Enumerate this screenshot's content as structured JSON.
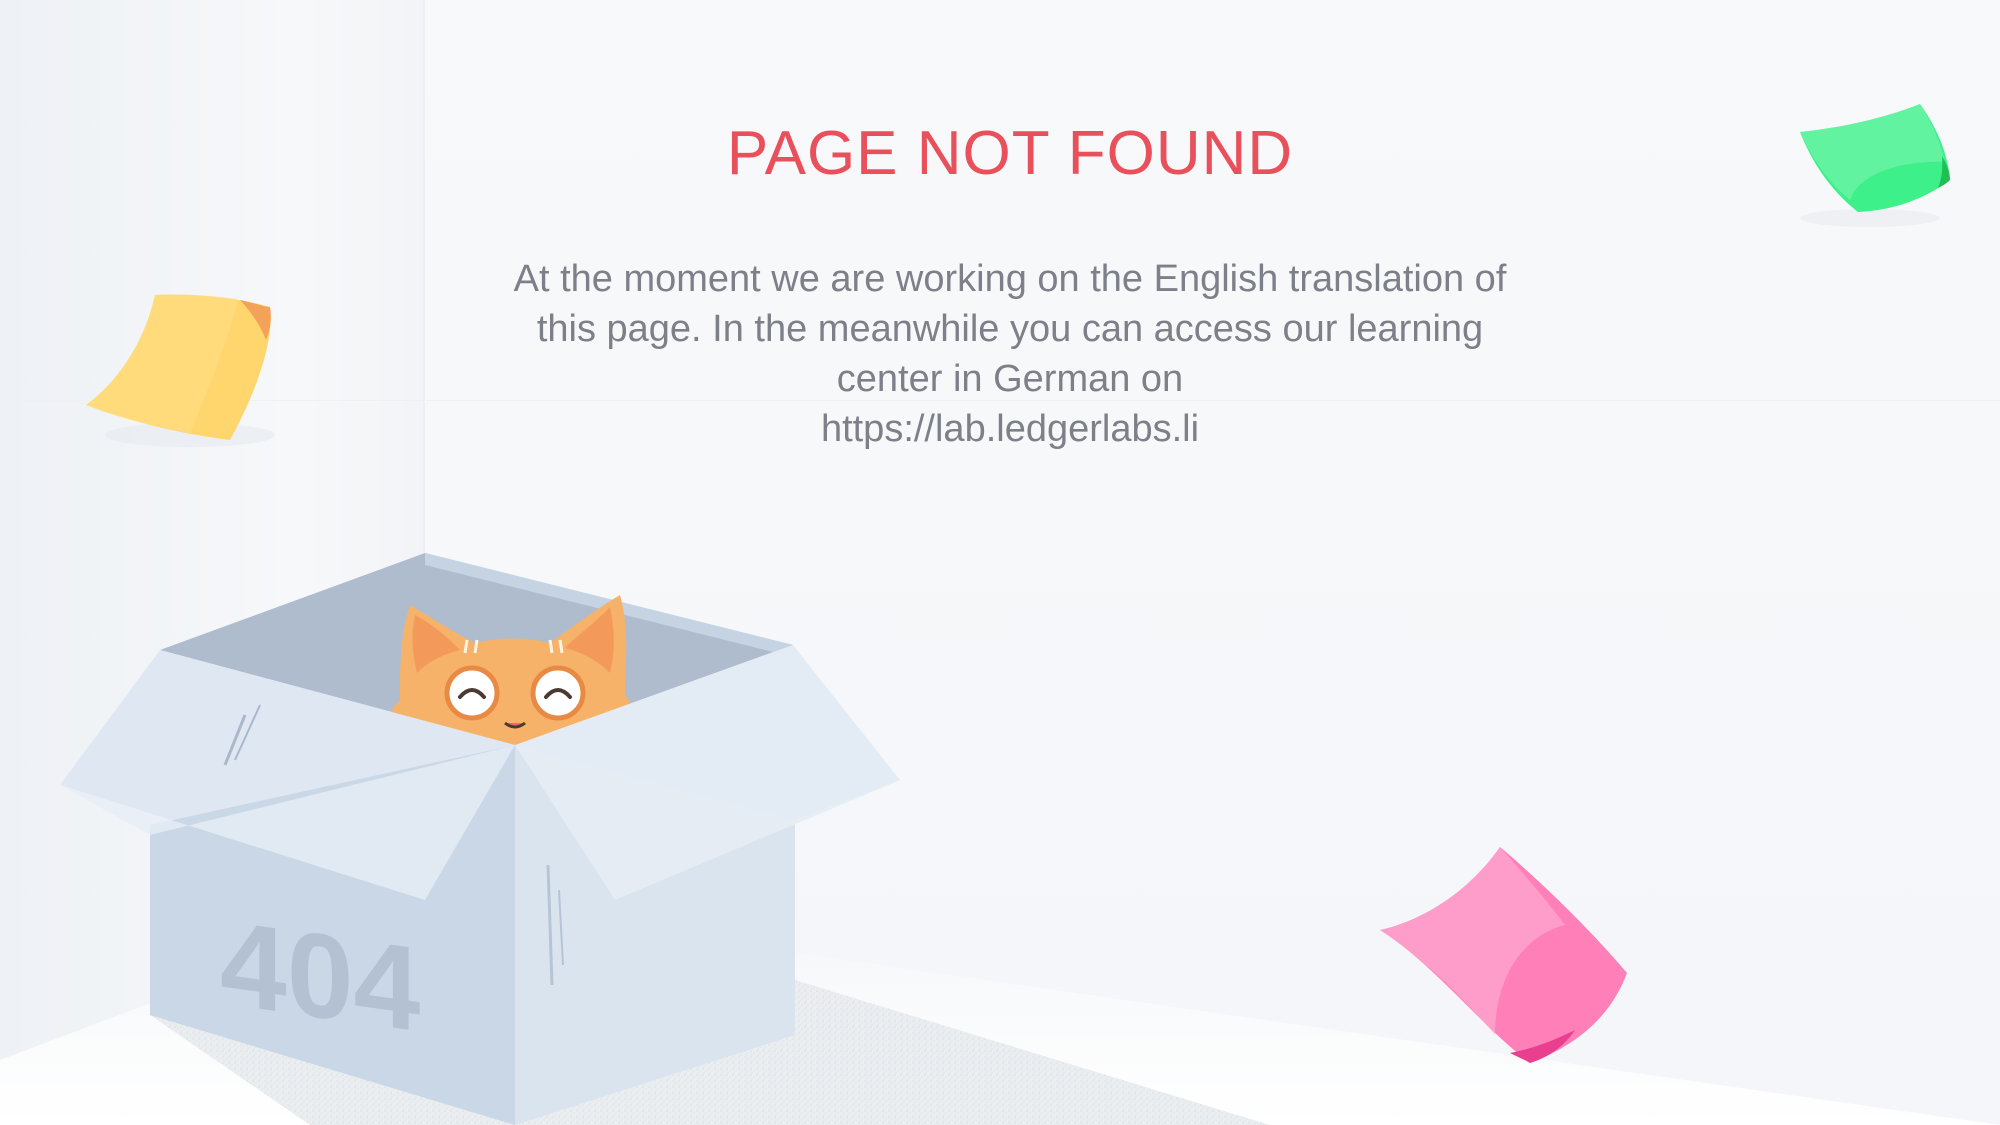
{
  "page": {
    "title": "PAGE NOT FOUND",
    "message_lines": [
      "At the moment we are working on the English translation of",
      "this page. In the meanwhile you can access our learning",
      "center in German on"
    ],
    "link_text": "https://lab.ledgerlabs.li",
    "box_label": "404"
  },
  "colors": {
    "title": "#e8505b",
    "text": "#7d8089",
    "note_yellow": "#ffd66e",
    "note_green": "#3df08a",
    "note_pink": "#ff7fb8",
    "box": "#c9d7e6",
    "cat": "#f7b26a"
  },
  "icons": {
    "cat": "cat-illustration",
    "box": "cardboard-box-illustration",
    "notes": [
      "yellow-sticky-note",
      "green-sticky-note",
      "pink-sticky-note"
    ]
  }
}
